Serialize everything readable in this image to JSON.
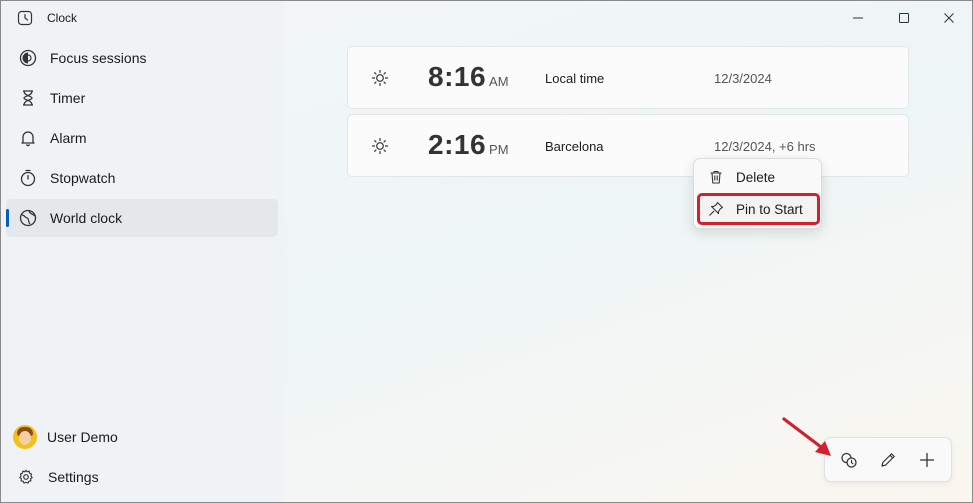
{
  "app": {
    "title": "Clock"
  },
  "sidebar": {
    "items": [
      {
        "label": "Focus sessions",
        "icon": "focus-icon"
      },
      {
        "label": "Timer",
        "icon": "hourglass-icon"
      },
      {
        "label": "Alarm",
        "icon": "bell-icon"
      },
      {
        "label": "Stopwatch",
        "icon": "stopwatch-icon"
      },
      {
        "label": "World clock",
        "icon": "globe-icon",
        "active": true
      }
    ],
    "user": {
      "name": "User Demo"
    },
    "settings_label": "Settings"
  },
  "clocks": [
    {
      "time": "8:16",
      "ampm": "AM",
      "place": "Local time",
      "date": "12/3/2024",
      "icon": "sun-icon"
    },
    {
      "time": "2:16",
      "ampm": "PM",
      "place": "Barcelona",
      "date": "12/3/2024, +6 hrs",
      "icon": "sun-icon"
    }
  ],
  "context_menu": {
    "items": [
      {
        "label": "Delete",
        "icon": "trash-icon"
      },
      {
        "label": "Pin to Start",
        "icon": "pin-icon",
        "highlighted": true
      }
    ]
  },
  "bottom_bar": {
    "buttons": [
      "compare-icon",
      "edit-icon",
      "add-icon"
    ]
  },
  "window_controls": [
    "minimize-icon",
    "maximize-icon",
    "close-icon"
  ],
  "colors": {
    "accent": "#005fb8",
    "highlight": "#d2202f"
  }
}
